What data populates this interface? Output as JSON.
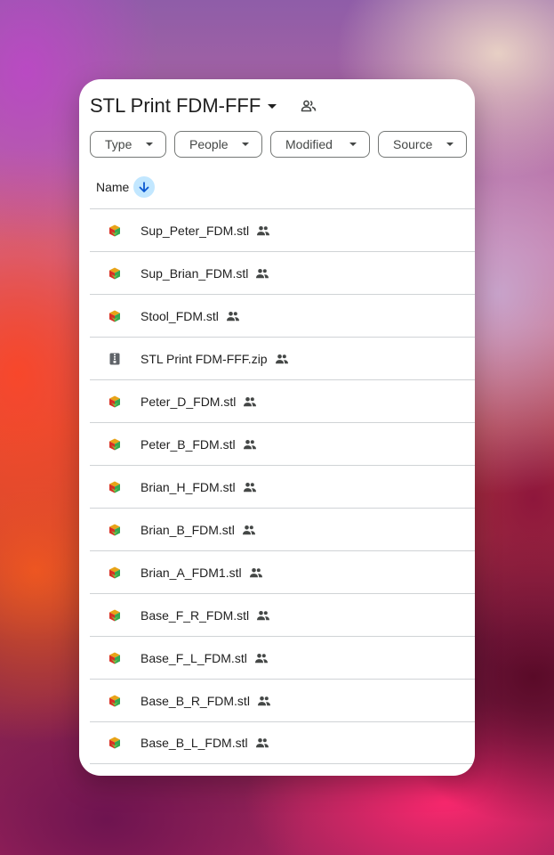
{
  "header": {
    "title": "STL Print FDM-FFF",
    "title_dropdown_icon": "caret-down-icon",
    "shared_icon": "people-icon"
  },
  "filters": {
    "type_label": "Type",
    "people_label": "People",
    "modified_label": "Modified",
    "source_label": "Source"
  },
  "sort": {
    "label": "Name",
    "direction_icon": "arrow-down-icon"
  },
  "files": [
    {
      "name": "Sup_Peter_FDM.stl",
      "kind": "stl"
    },
    {
      "name": "Sup_Brian_FDM.stl",
      "kind": "stl"
    },
    {
      "name": "Stool_FDM.stl",
      "kind": "stl"
    },
    {
      "name": "STL Print FDM-FFF.zip",
      "kind": "zip"
    },
    {
      "name": "Peter_D_FDM.stl",
      "kind": "stl"
    },
    {
      "name": "Peter_B_FDM.stl",
      "kind": "stl"
    },
    {
      "name": "Brian_H_FDM.stl",
      "kind": "stl"
    },
    {
      "name": "Brian_B_FDM.stl",
      "kind": "stl"
    },
    {
      "name": "Brian_A_FDM1.stl",
      "kind": "stl"
    },
    {
      "name": "Base_F_R_FDM.stl",
      "kind": "stl"
    },
    {
      "name": "Base_F_L_FDM.stl",
      "kind": "stl"
    },
    {
      "name": "Base_B_R_FDM.stl",
      "kind": "stl"
    },
    {
      "name": "Base_B_L_FDM.stl",
      "kind": "stl"
    }
  ],
  "colors": {
    "sort_accent": "#c2e7ff",
    "divider": "#d0d3d6"
  }
}
